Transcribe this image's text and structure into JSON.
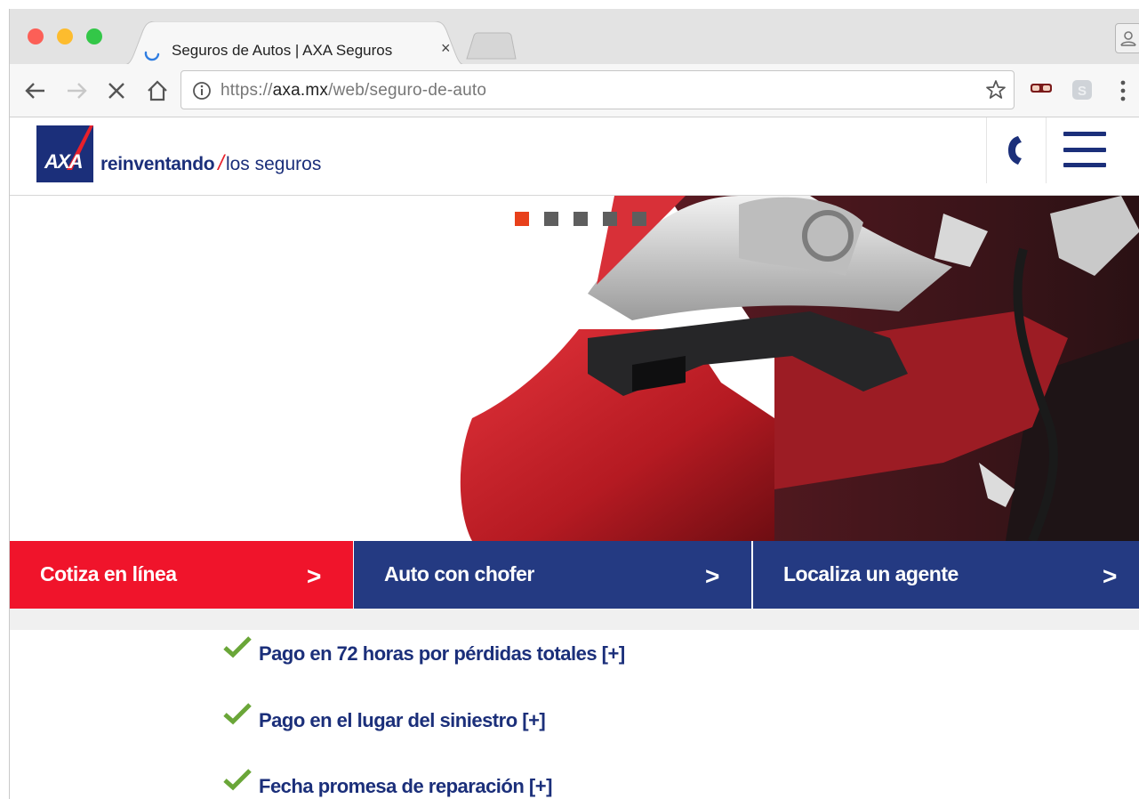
{
  "browser": {
    "tab": {
      "title": "Seguros de Autos | AXA Seguros",
      "close_glyph": "×"
    },
    "address_bar": {
      "scheme": "https://",
      "host": "axa.mx",
      "path": "/web/seguro-de-auto"
    }
  },
  "header": {
    "logo_text": "AXA",
    "tagline_strong": "reinventando",
    "tagline_slash": "/",
    "tagline_light": "los seguros"
  },
  "hero": {
    "carousel_dots": 5,
    "active_dot": 0,
    "image_description_icon": "damaged-red-car-image"
  },
  "cta": [
    {
      "label": "Cotiza en línea",
      "chevron": ">"
    },
    {
      "label": "Auto con chofer",
      "chevron": ">"
    },
    {
      "label": "Localiza un agente",
      "chevron": ">"
    }
  ],
  "benefits": [
    {
      "text": "Pago en 72 horas por pérdidas totales [+]"
    },
    {
      "text": "Pago en el lugar del siniestro [+]"
    },
    {
      "text": "Fecha promesa de reparación [+]"
    }
  ],
  "colors": {
    "axa_blue": "#1b2f7a",
    "cta_red": "#f0142b",
    "cta_blue": "#243a82",
    "check_green": "#6aa638",
    "dot_active": "#e8401b"
  }
}
